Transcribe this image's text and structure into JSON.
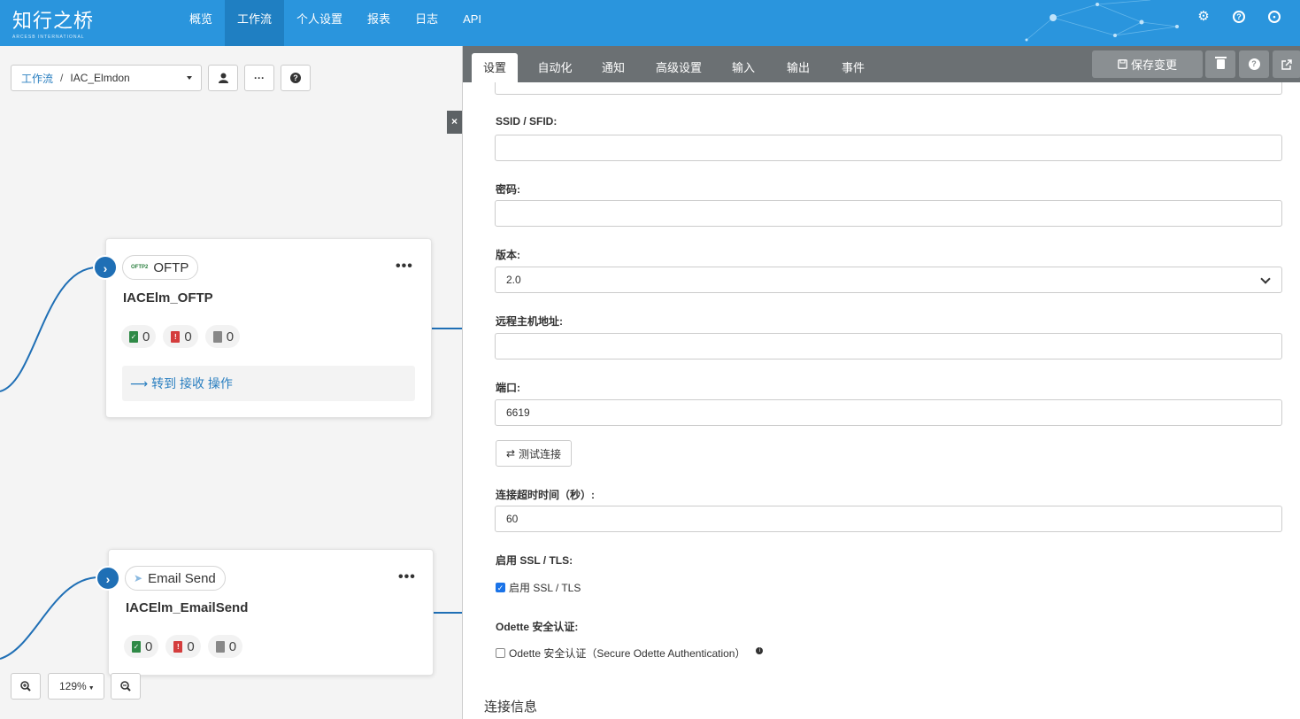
{
  "navbar": {
    "logo_main": "知行之桥",
    "logo_sub": "ARCESB INTERNATIONAL",
    "items": [
      {
        "label": "概览"
      },
      {
        "label": "工作流"
      },
      {
        "label": "个人设置"
      },
      {
        "label": "报表"
      },
      {
        "label": "日志"
      },
      {
        "label": "API"
      }
    ],
    "active_item": "工作流",
    "icons": [
      "gear-icon",
      "help-icon",
      "user-icon"
    ]
  },
  "canvas": {
    "breadcrumb": {
      "root": "工作流",
      "separator": "/",
      "current": "IAC_Elmdon"
    },
    "toolbar": [
      "user-icon",
      "more-icon",
      "help-icon"
    ],
    "nodes": [
      {
        "type_label": "OFTP",
        "type_logo": "OFTP2",
        "name": "IACElm_OFTP",
        "counts": {
          "success": "0",
          "error": "0",
          "pending": "0"
        },
        "goto_label": "转到 接收 操作"
      },
      {
        "type_label": "Email Send",
        "name": "IACElm_EmailSend",
        "counts": {
          "success": "0",
          "error": "0",
          "pending": "0"
        }
      }
    ],
    "zoom": "129%",
    "close_symbol": "×"
  },
  "panel": {
    "tabs": [
      {
        "label": "设置"
      },
      {
        "label": "自动化"
      },
      {
        "label": "通知"
      },
      {
        "label": "高级设置"
      },
      {
        "label": "输入"
      },
      {
        "label": "输出"
      },
      {
        "label": "事件"
      }
    ],
    "active_tab": "设置",
    "save_label": "保存变更",
    "fields": {
      "ssid_label": "SSID / SFID:",
      "ssid_value": "",
      "password_label": "密码:",
      "password_value": "",
      "version_label": "版本:",
      "version_value": "2.0",
      "host_label": "远程主机地址:",
      "host_value": "",
      "port_label": "端口:",
      "port_value": "6619",
      "test_label": "测试连接",
      "timeout_label": "连接超时时间（秒）:",
      "timeout_value": "60",
      "ssl_label": "启用 SSL / TLS:",
      "ssl_checkbox": "启用 SSL / TLS",
      "ssl_checked": true,
      "odette_label": "Odette 安全认证:",
      "odette_checkbox": "Odette 安全认证（Secure Odette Authentication）",
      "odette_checked": false
    },
    "section_title": "连接信息"
  },
  "colors": {
    "navbar": "#2a95dd",
    "nav_active": "#1f7fc2",
    "tabbar": "#6b7073",
    "link": "#2a7fc0",
    "node_arrow": "#1f6fb5"
  }
}
